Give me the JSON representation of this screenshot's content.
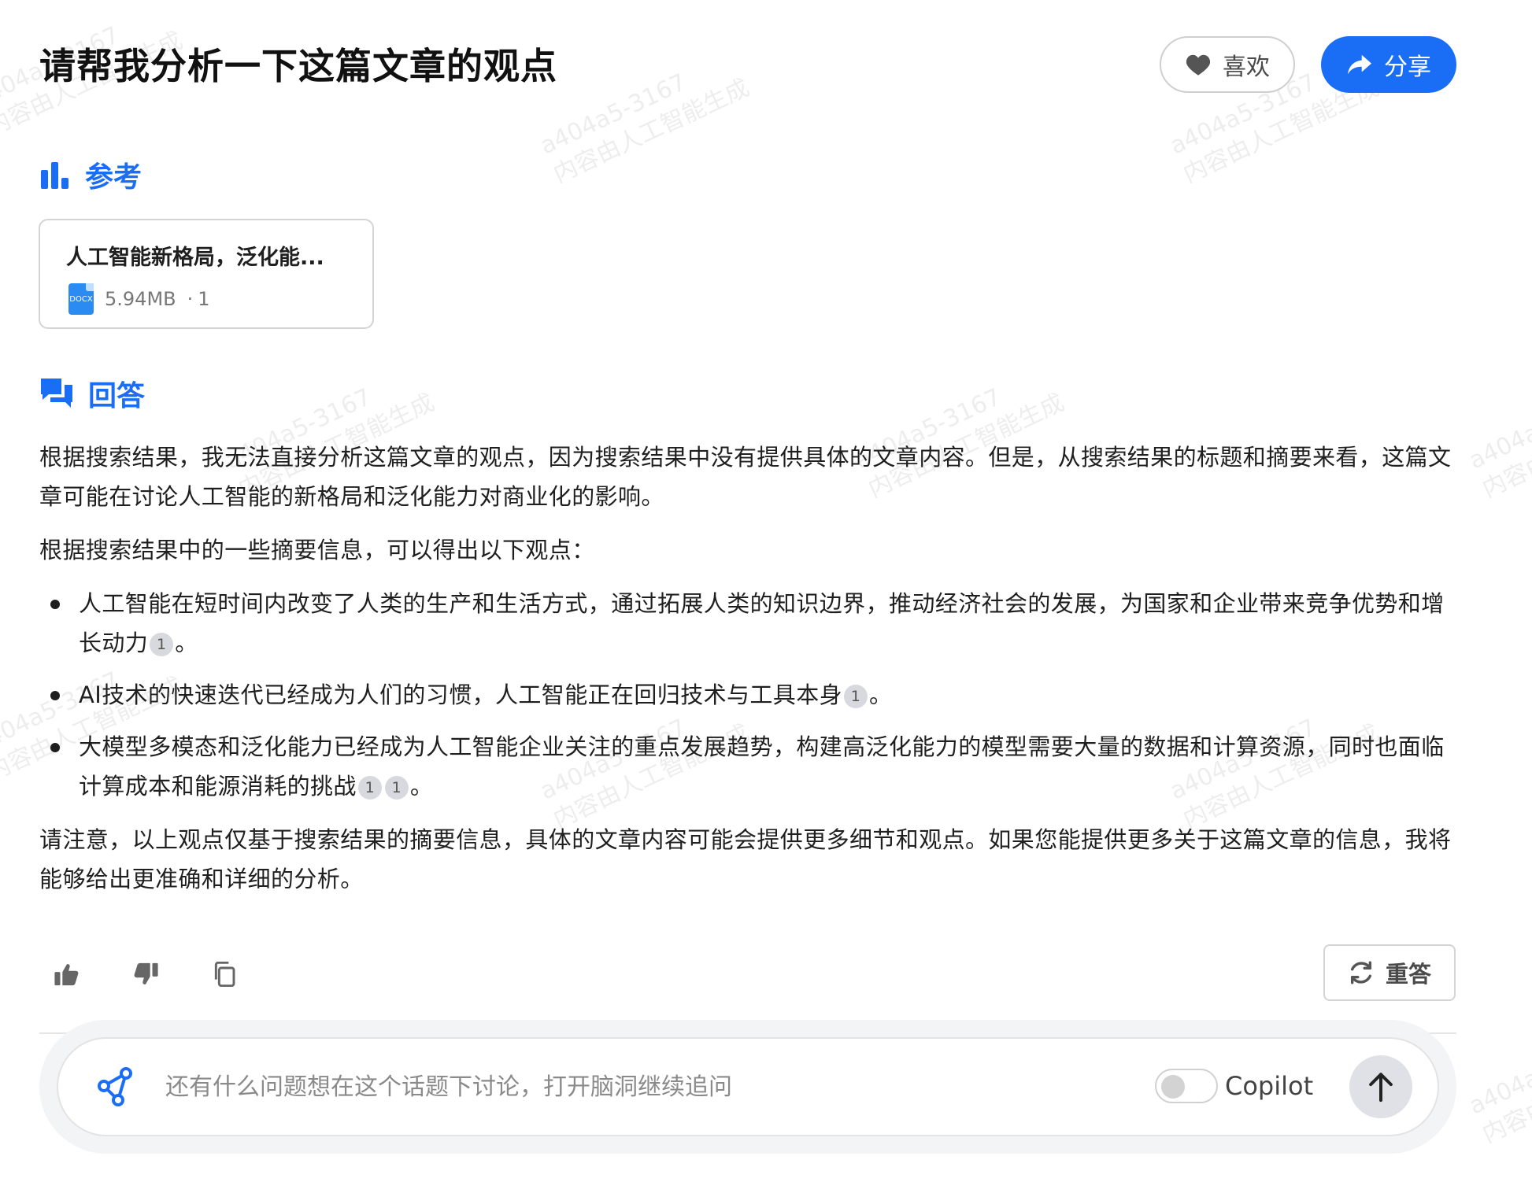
{
  "header": {
    "title": "请帮我分析一下这篇文章的观点",
    "like_label": "喜欢",
    "share_label": "分享"
  },
  "reference": {
    "section_label": "参考",
    "card": {
      "title": "人工智能新格局，泛化能...",
      "file_type": "DOCX",
      "size": "5.94MB",
      "separator": "·",
      "count": "1"
    }
  },
  "answer": {
    "section_label": "回答",
    "p1": "根据搜索结果，我无法直接分析这篇文章的观点，因为搜索结果中没有提供具体的文章内容。但是，从搜索结果的标题和摘要来看，这篇文章可能在讨论人工智能的新格局和泛化能力对商业化的影响。",
    "p2": "根据搜索结果中的一些摘要信息，可以得出以下观点：",
    "bullets": [
      {
        "text": "人工智能在短时间内改变了人类的生产和生活方式，通过拓展人类的知识边界，推动经济社会的发展，为国家和企业带来竞争优势和增长动力",
        "cites": [
          "1"
        ],
        "end": "。"
      },
      {
        "text": "AI技术的快速迭代已经成为人们的习惯，人工智能正在回归技术与工具本身",
        "cites": [
          "1"
        ],
        "end": "。"
      },
      {
        "text": "大模型多模态和泛化能力已经成为人工智能企业关注的重点发展趋势，构建高泛化能力的模型需要大量的数据和计算资源，同时也面临计算成本和能源消耗的挑战",
        "cites": [
          "1",
          "1"
        ],
        "end": "。"
      }
    ],
    "p3": "请注意，以上观点仅基于搜索结果的摘要信息，具体的文章内容可能会提供更多细节和观点。如果您能提供更多关于这篇文章的信息，我将能够给出更准确和详细的分析。"
  },
  "actions": {
    "thumbs_up_icon": "thumbs-up-icon",
    "thumbs_down_icon": "thumbs-down-icon",
    "copy_icon": "copy-icon",
    "reanswer_label": "重答"
  },
  "composer": {
    "placeholder": "还有什么问题想在这个话题下讨论，打开脑洞继续追问",
    "value": "",
    "copilot_label": "Copilot",
    "copilot_enabled": false
  },
  "watermark": {
    "line1": "a404a5-3167",
    "line2": "内容由人工智能生成"
  },
  "colors": {
    "accent": "#1a6ef5",
    "text": "#1f1f1f",
    "muted": "#777777"
  }
}
